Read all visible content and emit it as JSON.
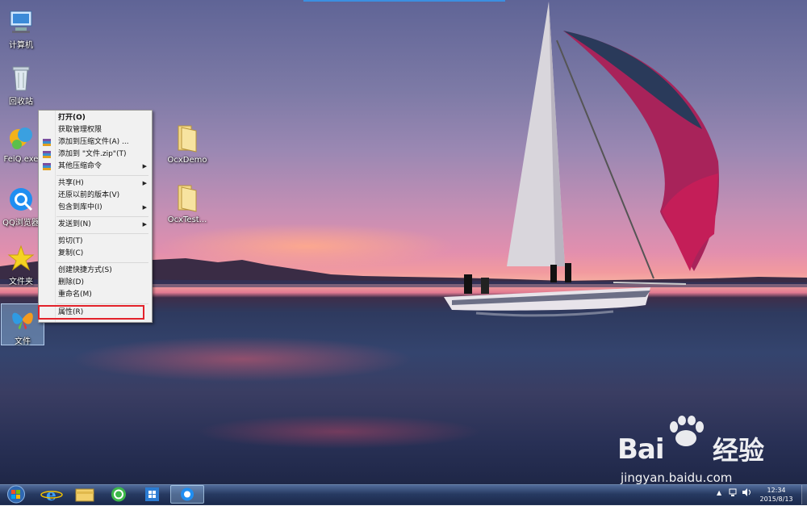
{
  "desktop": {
    "icons": [
      {
        "label": "计算机"
      },
      {
        "label": "回收站"
      },
      {
        "label": "FeiQ.exe"
      },
      {
        "label": "QQ浏览器"
      },
      {
        "label": "文件夹"
      },
      {
        "label": "文件"
      },
      {
        "label": "OcxDemo"
      },
      {
        "label": "OcxTest..."
      }
    ]
  },
  "context_menu": {
    "items": [
      {
        "label": "打开(O)"
      },
      {
        "label": "获取管理权限"
      },
      {
        "label": "添加到压缩文件(A) ..."
      },
      {
        "label": "添加到 \"文件.zip\"(T)"
      },
      {
        "label": "其他压缩命令"
      },
      {
        "label": "共享(H)"
      },
      {
        "label": "还原以前的版本(V)"
      },
      {
        "label": "包含到库中(I)"
      },
      {
        "label": "发送到(N)"
      },
      {
        "label": "剪切(T)"
      },
      {
        "label": "复制(C)"
      },
      {
        "label": "创建快捷方式(S)"
      },
      {
        "label": "删除(D)"
      },
      {
        "label": "重命名(M)"
      },
      {
        "label": "属性(R)"
      }
    ],
    "highlighted_item": "属性(R)",
    "highlight_color": "#e3222b"
  },
  "taskbar": {
    "pinned": [
      "start-orb",
      "internet-explorer",
      "file-explorer",
      "360-browser",
      "office-app",
      "qq-browser"
    ],
    "clock_time": "12:34",
    "clock_date": "2015/8/13"
  },
  "watermark": {
    "brand": "Bai",
    "product": "经验",
    "url": "jingyan.baidu.com"
  }
}
